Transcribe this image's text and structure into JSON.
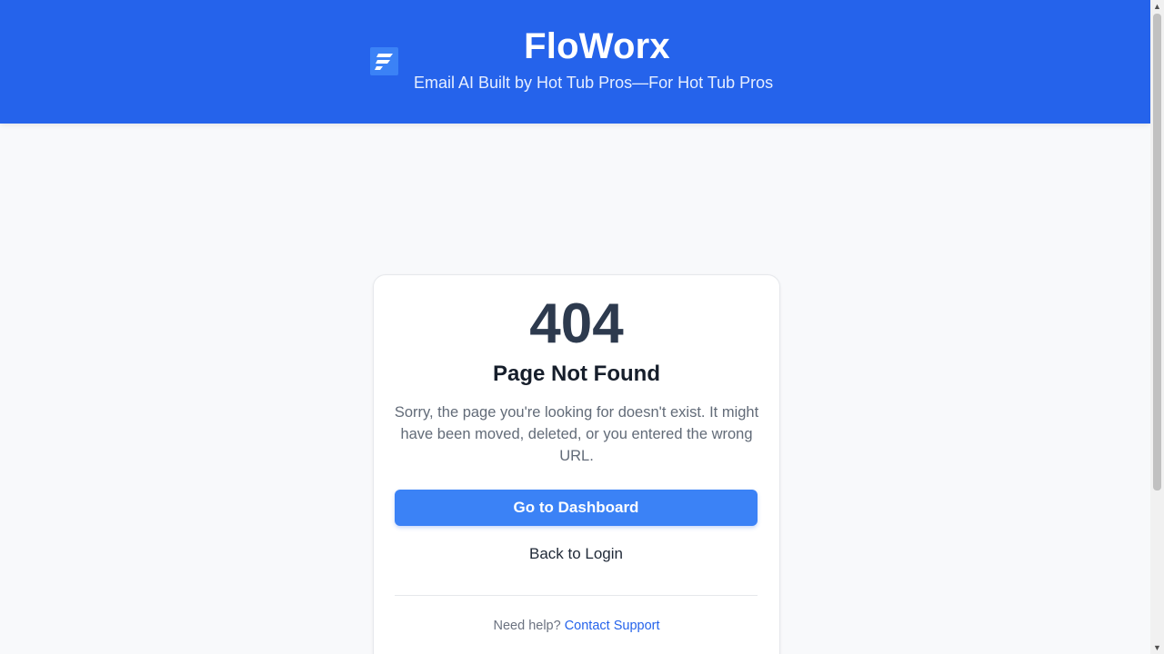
{
  "header": {
    "title": "FloWorx",
    "tagline": "Email AI Built by Hot Tub Pros—For Hot Tub Pros",
    "logo_icon": "floworx-logo-icon",
    "background_color": "#2563eb"
  },
  "error": {
    "code": "404",
    "title": "Page Not Found",
    "message": "Sorry, the page you're looking for doesn't exist. It might have been moved, deleted, or you entered the wrong URL."
  },
  "actions": {
    "primary_label": "Go to Dashboard",
    "secondary_label": "Back to Login",
    "primary_color": "#3b82f6"
  },
  "help": {
    "prefix": "Need help?",
    "link_label": "Contact Support",
    "link_color": "#2563eb"
  },
  "scrollbar": {
    "up_icon": "scroll-up-arrow-icon",
    "down_icon": "scroll-down-arrow-icon"
  }
}
